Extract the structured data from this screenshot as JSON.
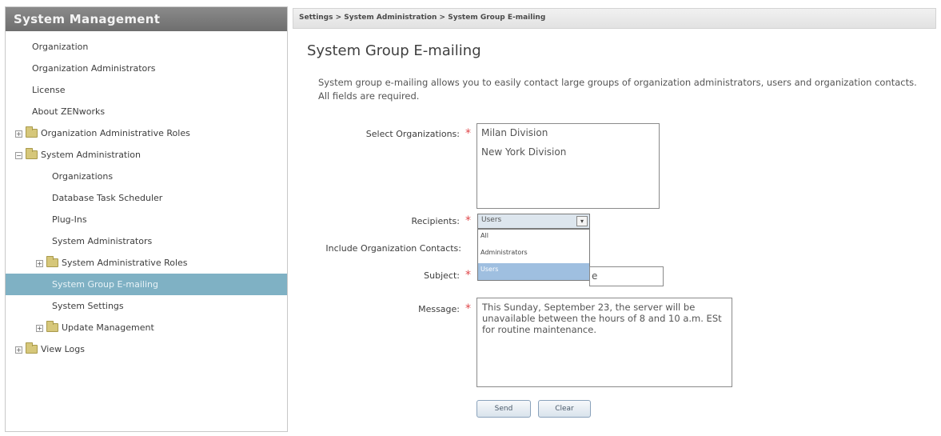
{
  "sidebar": {
    "title": "System Management",
    "items": [
      {
        "label": "Organization"
      },
      {
        "label": "Organization Administrators"
      },
      {
        "label": "License"
      },
      {
        "label": "About ZENworks"
      },
      {
        "label": "Organization Administrative Roles",
        "toggle": "+"
      },
      {
        "label": "System Administration",
        "toggle": "−"
      },
      {
        "label": "Organizations"
      },
      {
        "label": "Database Task Scheduler"
      },
      {
        "label": "Plug-Ins"
      },
      {
        "label": "System Administrators"
      },
      {
        "label": "System Administrative Roles",
        "toggle": "+"
      },
      {
        "label": "System Group E-mailing"
      },
      {
        "label": "System Settings"
      },
      {
        "label": "Update Management",
        "toggle": "+"
      },
      {
        "label": "View Logs",
        "toggle": "+"
      }
    ]
  },
  "breadcrumb": "Settings > System Administration > System Group E-mailing",
  "page_title": "System Group E-mailing",
  "description": "System group e-mailing allows you to easily contact large groups of organization administrators, users and organization contacts. All fields are required.",
  "form": {
    "organizations_label": "Select Organizations:",
    "organizations": [
      "Milan Division",
      "New York Division"
    ],
    "recipients_label": "Recipients:",
    "recipients_value": "Users",
    "recipients_options": [
      "All",
      "Administrators",
      "Users"
    ],
    "include_contacts_label": "Include Organization Contacts:",
    "subject_label": "Subject:",
    "subject_value_visible": "e",
    "message_label": "Message:",
    "message_value": "This Sunday, September 23, the server will be unavailable between the hours of 8 and 10 a.m. ESt for routine maintenance.",
    "required_marker": "*"
  },
  "buttons": {
    "send": "Send",
    "clear": "Clear"
  },
  "colors": {
    "selected_item": "#7fb1c4",
    "required": "#e0484b",
    "header": "#7a7a7a"
  }
}
